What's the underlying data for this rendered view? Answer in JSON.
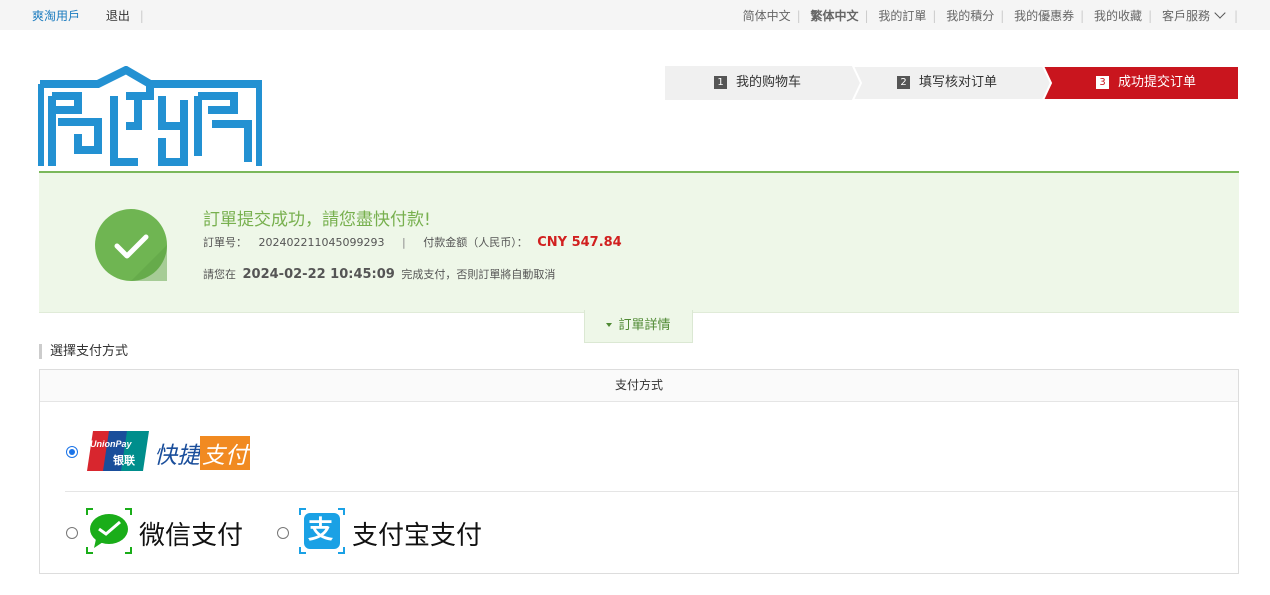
{
  "topbar": {
    "user": "爽淘用戶",
    "logout": "退出",
    "links": [
      "简体中文",
      "繁体中文",
      "我的訂單",
      "我的積分",
      "我的優惠券",
      "我的收藏",
      "客戶服務"
    ]
  },
  "steps": [
    {
      "num": "1",
      "label": "我的购物车"
    },
    {
      "num": "2",
      "label": "填写核对订单"
    },
    {
      "num": "3",
      "label": "成功提交订单"
    }
  ],
  "success": {
    "title": "訂單提交成功，請您盡快付款!",
    "order_label": "訂單号：",
    "order_no": "202402211045099293",
    "amount_label": "付款金额（人民币）：",
    "amount": "CNY 547.84",
    "deadline_prefix": "請您在",
    "deadline": "2024-02-22 10:45:09",
    "deadline_suffix": "完成支付，否則訂單將自動取消"
  },
  "details_tab": "訂單詳情",
  "payment": {
    "section_title": "選擇支付方式",
    "header": "支付方式",
    "unionpay_logo_en": "UnionPay",
    "unionpay_logo_cn": "银联",
    "unionpay_label": "快捷",
    "unionpay_label2": "支付",
    "wechat_label": "微信支付",
    "alipay_label": "支付宝支付",
    "alipay_glyph": "支",
    "selected": "unionpay"
  },
  "colors": {
    "brand_blue": "#1a7bbf",
    "active_step": "#c9151e",
    "success_green": "#6fb552",
    "amount_red": "#d1201f"
  }
}
